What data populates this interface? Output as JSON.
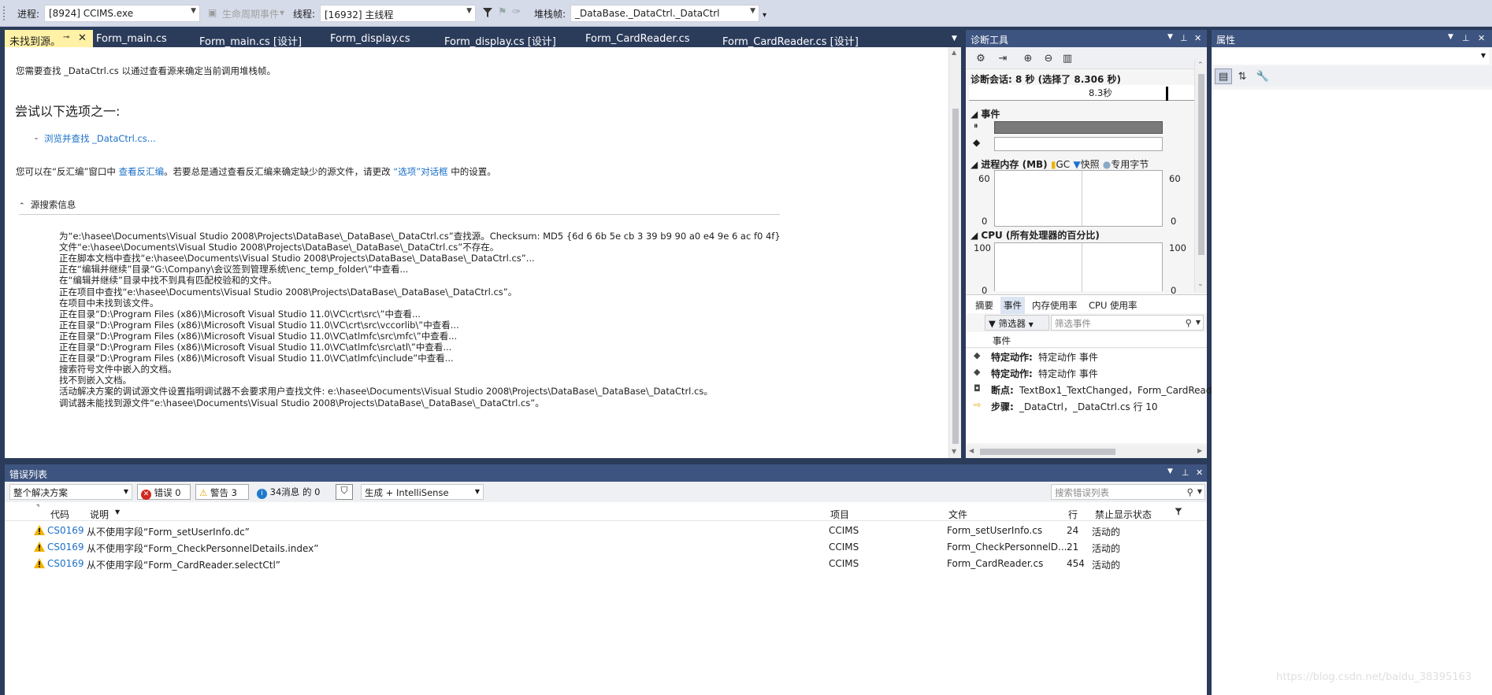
{
  "toolbar": {
    "process_label": "进程:",
    "process_value": "[8924] CCIMS.exe",
    "lifecycle_label": "生命周期事件",
    "thread_label": "线程:",
    "thread_value": "[16932] 主线程",
    "stackframe_label": "堆栈帧:",
    "stackframe_value": "_DataBase._DataCtrl._DataCtrl"
  },
  "doc_tabs": [
    {
      "label": "未找到源。"
    },
    {
      "label": "Form_main.cs"
    },
    {
      "label": "Form_main.cs [设计]"
    },
    {
      "label": "Form_display.cs"
    },
    {
      "label": "Form_display.cs [设计]"
    },
    {
      "label": "Form_CardReader.cs"
    },
    {
      "label": "Form_CardReader.cs [设计]"
    }
  ],
  "source_not_found": {
    "intro": "您需要查找 _DataCtrl.cs 以通过查看源来确定当前调用堆栈帧。",
    "try_heading": "尝试以下选项之一:",
    "browse_bullet": "-",
    "browse_link": "浏览并查找 _DataCtrl.cs...",
    "disasm_prefix": "您可以在“反汇编”窗口中 ",
    "disasm_link": "查看反汇编",
    "disasm_middle": "。若要总是通过查看反汇编来确定缺少的源文件，请更改 ",
    "options_link": "“选项”对话框",
    "disasm_suffix": " 中的设置。",
    "search_info_title": "源搜索信息",
    "search_lines": [
      "为“e:\\hasee\\Documents\\Visual Studio 2008\\Projects\\DataBase\\_DataBase\\_DataCtrl.cs”查找源。Checksum: MD5 {6d 6 6b 5e cb 3 39 b9 90 a0 e4 9e 6 ac f0 4f}",
      "文件“e:\\hasee\\Documents\\Visual Studio 2008\\Projects\\DataBase\\_DataBase\\_DataCtrl.cs”不存在。",
      "正在脚本文档中查找“e:\\hasee\\Documents\\Visual Studio 2008\\Projects\\DataBase\\_DataBase\\_DataCtrl.cs”...",
      "正在“编辑并继续”目录“G:\\Company\\会议签到管理系统\\enc_temp_folder\\”中查看...",
      "在“编辑并继续”目录中找不到具有匹配校验和的文件。",
      "正在项目中查找“e:\\hasee\\Documents\\Visual Studio 2008\\Projects\\DataBase\\_DataBase\\_DataCtrl.cs”。",
      "在项目中未找到该文件。",
      "正在目录“D:\\Program Files (x86)\\Microsoft Visual Studio 11.0\\VC\\crt\\src\\”中查看...",
      "正在目录“D:\\Program Files (x86)\\Microsoft Visual Studio 11.0\\VC\\crt\\src\\vccorlib\\”中查看...",
      "正在目录“D:\\Program Files (x86)\\Microsoft Visual Studio 11.0\\VC\\atlmfc\\src\\mfc\\”中查看...",
      "正在目录“D:\\Program Files (x86)\\Microsoft Visual Studio 11.0\\VC\\atlmfc\\src\\atl\\”中查看...",
      "正在目录“D:\\Program Files (x86)\\Microsoft Visual Studio 11.0\\VC\\atlmfc\\include”中查看...",
      "搜索符号文件中嵌入的文档。",
      "找不到嵌入文档。",
      "活动解决方案的调试源文件设置指明调试器不会要求用户查找文件: e:\\hasee\\Documents\\Visual Studio 2008\\Projects\\DataBase\\_DataBase\\_DataCtrl.cs。",
      "调试器未能找到源文件“e:\\hasee\\Documents\\Visual Studio 2008\\Projects\\DataBase\\_DataBase\\_DataCtrl.cs”。"
    ]
  },
  "diagnostics": {
    "title": "诊断工具",
    "session": "诊断会话: 8 秒 (选择了 8.306 秒)",
    "timeline_label": "8.3秒",
    "events_section": "事件",
    "memory_section": "进程内存 (MB)",
    "legend_gc": "GC",
    "legend_snapshot": "快照",
    "legend_private": "专用字节",
    "mem_max": "60",
    "mem_min": "0",
    "cpu_section": "CPU (所有处理器的百分比)",
    "cpu_max": "100",
    "cpu_min": "0",
    "tabs": [
      "摘要",
      "事件",
      "内存使用率",
      "CPU 使用率"
    ],
    "filter_label": "筛选器",
    "search_placeholder": "筛选事件",
    "event_col": "事件",
    "events": [
      {
        "bold": "特定动作:",
        "text": " 特定动作 事件"
      },
      {
        "bold": "特定动作:",
        "text": " 特定动作 事件"
      },
      {
        "bold": "断点:",
        "text": " TextBox1_TextChanged，Form_CardReade"
      },
      {
        "bold": "步骤:",
        "text": " _DataCtrl，_DataCtrl.cs 行 10"
      }
    ]
  },
  "properties": {
    "title": "属性"
  },
  "error_list": {
    "title": "错误列表",
    "scope": "整个解决方案",
    "errors_label": "错误 0",
    "warnings_label": "警告 3",
    "messages_label": "34消息 的 0",
    "build_filter": "生成 + IntelliSense",
    "search_placeholder": "搜索错误列表",
    "columns": {
      "code": "代码",
      "description": "说明",
      "project": "项目",
      "file": "文件",
      "line": "行",
      "suppression": "禁止显示状态"
    },
    "rows": [
      {
        "code": "CS0169",
        "description": "从不使用字段“Form_setUserInfo.dc”",
        "project": "CCIMS",
        "file": "Form_setUserInfo.cs",
        "line": "24",
        "state": "活动的"
      },
      {
        "code": "CS0169",
        "description": "从不使用字段“Form_CheckPersonnelDetails.index”",
        "project": "CCIMS",
        "file": "Form_CheckPersonnelD...",
        "line": "21",
        "state": "活动的"
      },
      {
        "code": "CS0169",
        "description": "从不使用字段“Form_CardReader.selectCtl”",
        "project": "CCIMS",
        "file": "Form_CardReader.cs",
        "line": "454",
        "state": "活动的"
      }
    ]
  },
  "watermark": "https://blog.csdn.net/baidu_38395163"
}
